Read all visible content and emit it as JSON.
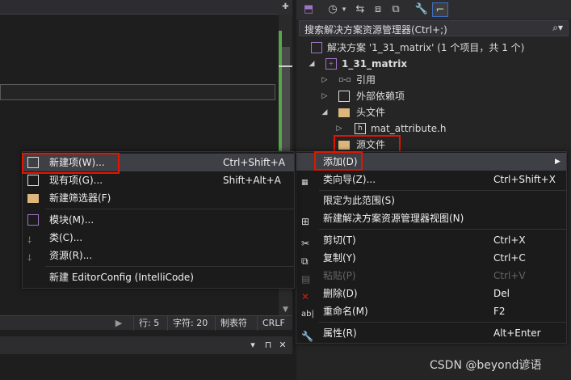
{
  "editor": {
    "status": {
      "line": "行: 5",
      "char": "字符: 20",
      "tabs": "制表符",
      "eol": "CRLF"
    },
    "bottom_buttons": [
      "▾",
      "⊓",
      "✕"
    ]
  },
  "solution_explorer": {
    "search_placeholder": "搜索解决方案资源管理器(Ctrl+;)",
    "tree": {
      "solution": "解决方案 '1_31_matrix' (1 个项目，共 1 个)",
      "project": "1_31_matrix",
      "references": "引用",
      "external_deps": "外部依赖项",
      "header_files": "头文件",
      "header_file": "mat_attribute.h",
      "source_files": "源文件"
    }
  },
  "context_menu": {
    "items": [
      {
        "label": "添加(D)",
        "shortcut": ""
      },
      {
        "label": "类向导(Z)...",
        "shortcut": "Ctrl+Shift+X"
      },
      {
        "label": "限定为此范围(S)",
        "shortcut": ""
      },
      {
        "label": "新建解决方案资源管理器视图(N)",
        "shortcut": ""
      },
      {
        "label": "剪切(T)",
        "shortcut": "Ctrl+X"
      },
      {
        "label": "复制(Y)",
        "shortcut": "Ctrl+C"
      },
      {
        "label": "粘贴(P)",
        "shortcut": "Ctrl+V"
      },
      {
        "label": "删除(D)",
        "shortcut": "Del"
      },
      {
        "label": "重命名(M)",
        "shortcut": "F2"
      },
      {
        "label": "属性(R)",
        "shortcut": "Alt+Enter"
      }
    ]
  },
  "add_submenu": {
    "items": [
      {
        "label": "新建项(W)...",
        "shortcut": "Ctrl+Shift+A"
      },
      {
        "label": "现有项(G)...",
        "shortcut": "Shift+Alt+A"
      },
      {
        "label": "新建筛选器(F)",
        "shortcut": ""
      },
      {
        "label": "模块(M)...",
        "shortcut": ""
      },
      {
        "label": "类(C)...",
        "shortcut": ""
      },
      {
        "label": "资源(R)...",
        "shortcut": ""
      },
      {
        "label": "新建 EditorConfig (IntelliCode)",
        "shortcut": ""
      }
    ]
  },
  "watermark": "CSDN @beyond谚语",
  "colors": {
    "highlight_border": "#e51400",
    "accent_green": "#57a64a",
    "folder": "#dcb67a",
    "project_icon": "#a074c4"
  }
}
